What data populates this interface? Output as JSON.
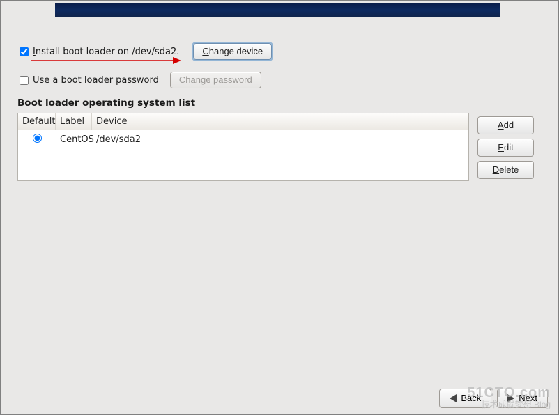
{
  "banner": {
    "present": true
  },
  "install": {
    "checked": true,
    "label_pre": "I",
    "label_rest": "nstall boot loader on /dev/sda2.",
    "change_device_pre": "C",
    "change_device_rest": "hange device"
  },
  "password": {
    "checked": false,
    "label_pre": "U",
    "label_rest": "se a boot loader password",
    "change_pw": "Change password",
    "change_pw_enabled": false
  },
  "list": {
    "title": "Boot loader operating system list",
    "columns": {
      "default": "Default",
      "label": "Label",
      "device": "Device"
    },
    "rows": [
      {
        "selected": true,
        "label": "CentOS",
        "device": "/dev/sda2"
      }
    ]
  },
  "side": {
    "add_pre": "A",
    "add_rest": "dd",
    "edit_pre": "E",
    "edit_rest": "dit",
    "delete_pre": "D",
    "delete_rest": "elete"
  },
  "nav": {
    "back_pre": "B",
    "back_rest": "ack",
    "next_pre": "N",
    "next_rest": "ext"
  },
  "watermark": {
    "line1": "51CTO.com",
    "line2": "技术成就梦想   Blog"
  }
}
